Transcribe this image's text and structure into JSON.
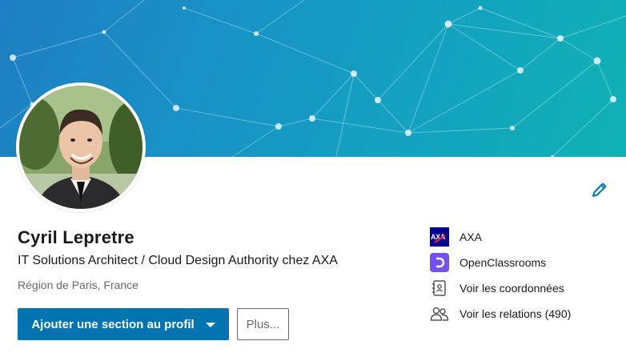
{
  "profile": {
    "name": "Cyril Lepretre",
    "headline": "IT Solutions Architect / Cloud Design Authority chez AXA",
    "location": "Région de Paris, France"
  },
  "actions": {
    "primary_label": "Ajouter une section au profil",
    "more_label": "Plus..."
  },
  "sidebar": {
    "items": [
      {
        "label": "AXA",
        "icon": "axa-logo"
      },
      {
        "label": "OpenClassrooms",
        "icon": "openclassrooms-logo"
      },
      {
        "label": "Voir les coordonnées",
        "icon": "contact-card-icon"
      },
      {
        "label": "Voir les relations (490)",
        "icon": "people-icon"
      }
    ]
  },
  "colors": {
    "primary": "#0073b1",
    "banner_start": "#1f7fc4",
    "banner_end": "#10b2b4",
    "axa_blue": "#00008f",
    "axa_red": "#ff1721",
    "openclassrooms_purple": "#7451eb"
  }
}
